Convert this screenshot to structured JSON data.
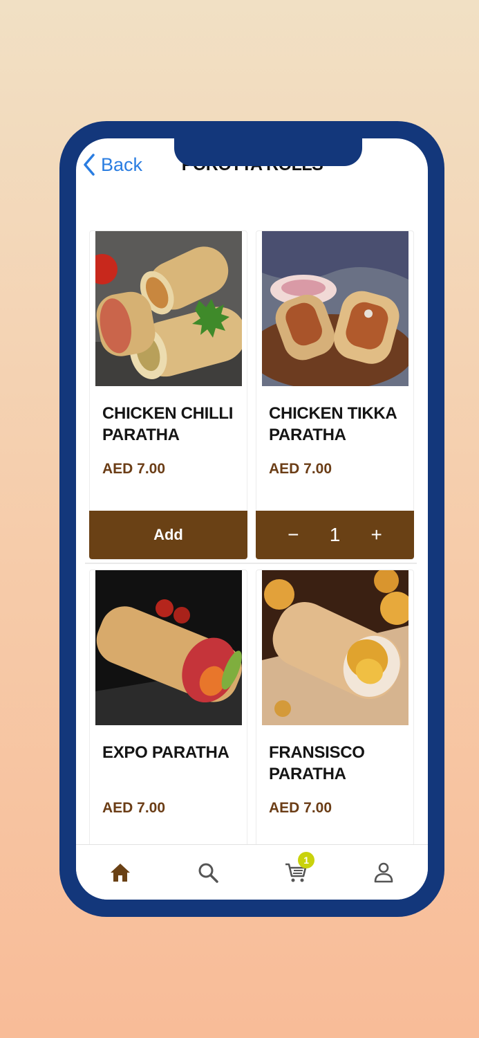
{
  "nav": {
    "back_label": "Back",
    "title": "POROTTA ROLLS"
  },
  "products": [
    {
      "name": "CHICKEN CHILLI PARATHA",
      "price": "AED 7.00",
      "action": "add",
      "add_label": "Add"
    },
    {
      "name": "CHICKEN TIKKA PARATHA",
      "price": "AED 7.00",
      "action": "stepper",
      "quantity": "1",
      "minus": "−",
      "plus": "+"
    },
    {
      "name": "EXPO PARATHA",
      "price": "AED 7.00"
    },
    {
      "name": "FRANSISCO PARATHA",
      "price": "AED 7.00"
    }
  ],
  "tabbar": {
    "items": [
      {
        "icon": "home-icon",
        "active": true
      },
      {
        "icon": "search-icon"
      },
      {
        "icon": "cart-icon",
        "badge": "1"
      },
      {
        "icon": "profile-icon"
      }
    ]
  },
  "colors": {
    "frame": "#13377b",
    "accent": "#6a4115",
    "link": "#2a7de1",
    "badge": "#c9d20c"
  }
}
